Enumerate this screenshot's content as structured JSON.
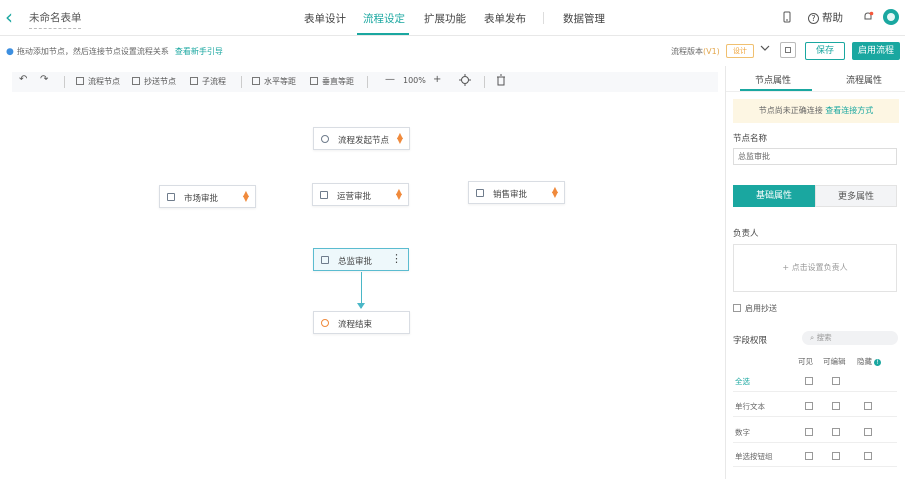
{
  "header": {
    "back_icon": "chevron-left-icon",
    "form_name": "未命名表单",
    "tabs": [
      {
        "label": "表单设计",
        "active": false
      },
      {
        "label": "流程设定",
        "active": true
      },
      {
        "label": "扩展功能",
        "active": false
      },
      {
        "label": "表单发布",
        "active": false
      },
      {
        "label": "数据管理",
        "active": false
      }
    ],
    "help_label": "帮助",
    "accent_color": "#1aa7a0"
  },
  "subbar": {
    "hint": "拖动添加节点，然后连接节点设置流程关系",
    "hint_link": "查看新手引导",
    "version_label": "流程版本",
    "version_value": "(V1)",
    "version_badge": "设计",
    "save_label": "保存",
    "enable_label": "启用流程"
  },
  "toolbar": {
    "flow_node": "流程节点",
    "cc_node": "抄送节点",
    "subflow": "子流程",
    "h_space": "水平等距",
    "v_space": "垂直等距",
    "zoom": "100%"
  },
  "nodes": {
    "start": "流程发起节点",
    "market": "市场审批",
    "ops": "运营审批",
    "sales": "销售审批",
    "director": "总监审批",
    "end": "流程结束"
  },
  "panel": {
    "tab_node": "节点属性",
    "tab_flow": "流程属性",
    "warning": "节点尚未正确连接",
    "warning_link": "查看连接方式",
    "name_label": "节点名称",
    "name_value": "总监审批",
    "seg_basic": "基础属性",
    "seg_more": "更多属性",
    "assignee_label": "负责人",
    "assignee_placeholder": "点击设置负责人",
    "cc_label": "启用抄送",
    "perm_label": "字段权限",
    "search_placeholder": "搜索",
    "col_visible": "可见",
    "col_editable": "可编辑",
    "col_hidden": "隐藏",
    "rows": [
      {
        "name": "全选"
      },
      {
        "name": "单行文本"
      },
      {
        "name": "数字"
      },
      {
        "name": "单选按钮组"
      }
    ]
  }
}
